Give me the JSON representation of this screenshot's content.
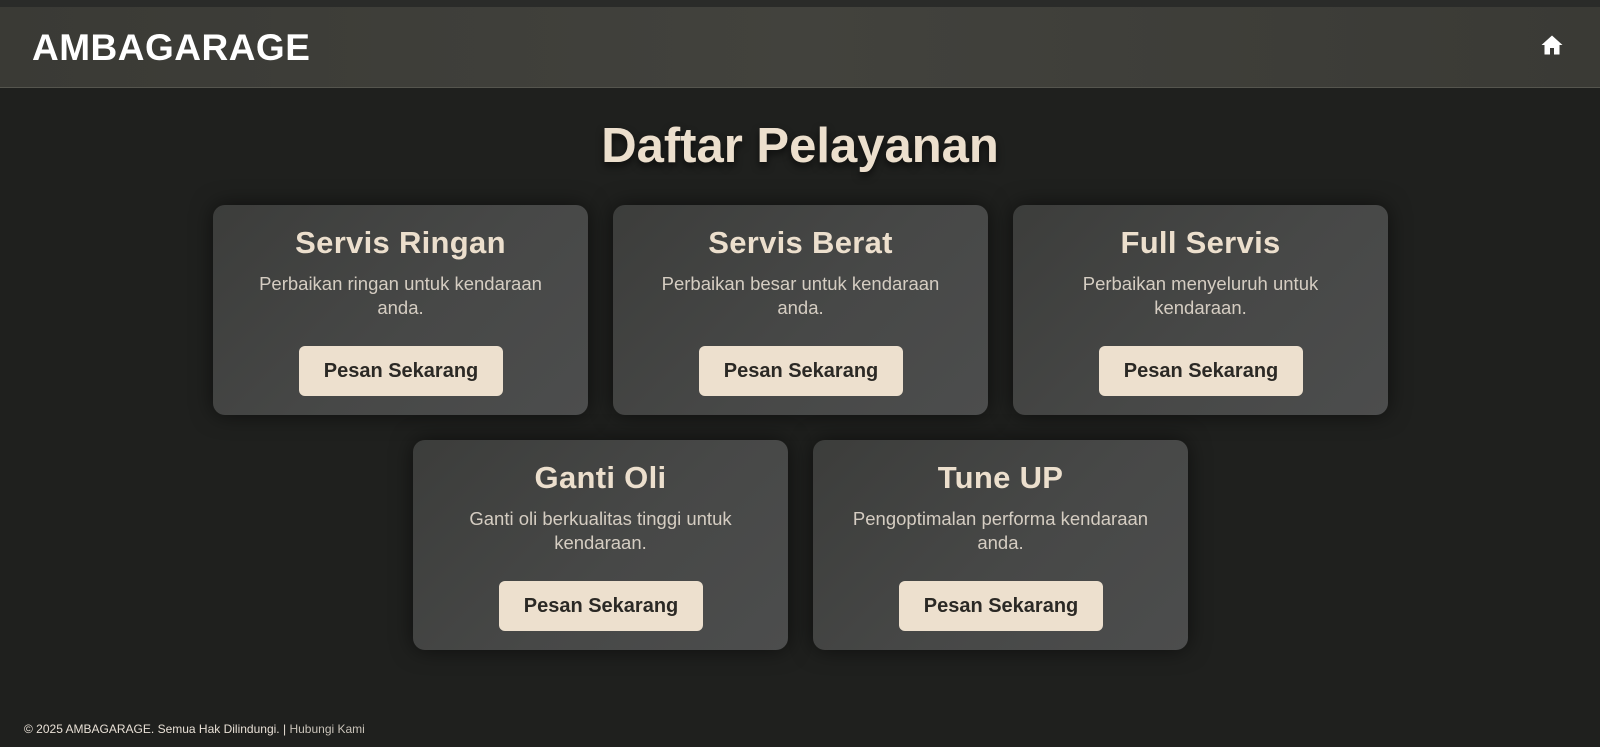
{
  "header": {
    "brand": "AMBAGARAGE",
    "home_icon": "home-icon"
  },
  "page_title": "Daftar Pelayanan",
  "services": [
    {
      "title": "Servis Ringan",
      "description": "Perbaikan ringan untuk kendaraan anda.",
      "button": "Pesan Sekarang"
    },
    {
      "title": "Servis Berat",
      "description": "Perbaikan besar untuk kendaraan anda.",
      "button": "Pesan Sekarang"
    },
    {
      "title": "Full Servis",
      "description": "Perbaikan menyeluruh untuk kendaraan.",
      "button": "Pesan Sekarang"
    },
    {
      "title": "Ganti Oli",
      "description": "Ganti oli berkualitas tinggi untuk kendaraan.",
      "button": "Pesan Sekarang"
    },
    {
      "title": "Tune UP",
      "description": "Pengoptimalan performa kendaraan anda.",
      "button": "Pesan Sekarang"
    }
  ],
  "footer": {
    "copyright": "© 2025 AMBAGARAGE. Semua Hak Dilindungi.",
    "separator": "|",
    "contact_link": "Hubungi Kami"
  },
  "colors": {
    "background": "#1f201e",
    "header": "#3e3e39",
    "card": "#464746",
    "accent": "#ede0ce",
    "title_text": "#ecdfcd"
  }
}
